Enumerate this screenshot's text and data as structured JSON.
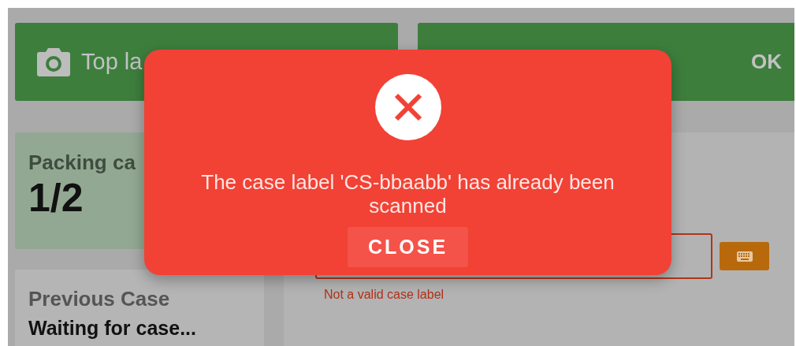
{
  "top_buttons": [
    {
      "kind": "camera",
      "label": "Top la"
    },
    {
      "kind": "status",
      "label": "OK"
    }
  ],
  "packing_card": {
    "title": "Packing ca",
    "count": "1/2"
  },
  "previous_case": {
    "title": "Previous Case",
    "value": "Waiting for case..."
  },
  "case_input": {
    "error": "Not a valid case label"
  },
  "dialog": {
    "message": "The case label 'CS-bbaabb' has already been scanned",
    "button": "CLOSE"
  }
}
